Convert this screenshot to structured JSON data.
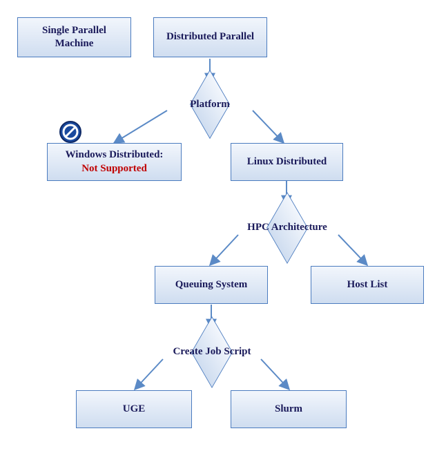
{
  "nodes": {
    "single_parallel": "Single Parallel Machine",
    "distributed_parallel": "Distributed Parallel",
    "platform": "Platform",
    "windows_line1": "Windows Distributed:",
    "windows_line2": "Not Supported",
    "linux_distributed": "Linux Distributed",
    "hpc_architecture": "HPC Architecture",
    "queuing_system": "Queuing System",
    "host_list": "Host List",
    "create_job_script": "Create Job Script",
    "uge": "UGE",
    "slurm": "Slurm"
  },
  "icon": "prohibit-icon"
}
